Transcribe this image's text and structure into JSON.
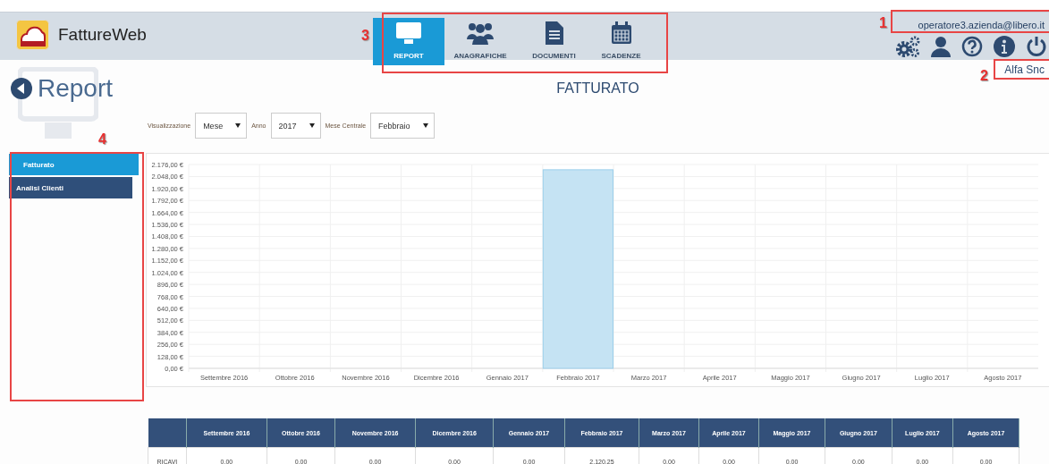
{
  "app": {
    "name": "FattureWeb"
  },
  "nav": [
    {
      "label": "REPORT",
      "selected": true
    },
    {
      "label": "ANAGRAFICHE",
      "selected": false
    },
    {
      "label": "DOCUMENTI",
      "selected": false
    },
    {
      "label": "SCADENZE",
      "selected": false
    }
  ],
  "user": {
    "email": "operatore3.azienda@libero.it",
    "company": "Alfa Snc"
  },
  "page": {
    "title": "Report",
    "heading": "FATTURATO"
  },
  "filters": [
    {
      "label": "Visualizzazione",
      "value": "Mese"
    },
    {
      "label": "Anno",
      "value": "2017"
    },
    {
      "label": "Mese Centrale",
      "value": "Febbraio"
    }
  ],
  "sidebar": {
    "items": [
      {
        "label": "Fatturato",
        "selected": true
      },
      {
        "label": "Analisi Clienti",
        "selected": false
      }
    ]
  },
  "chart_data": {
    "type": "bar",
    "categories": [
      "Settembre 2016",
      "Ottobre 2016",
      "Novembre 2016",
      "Dicembre 2016",
      "Gennaio 2017",
      "Febbraio 2017",
      "Marzo 2017",
      "Aprile 2017",
      "Maggio 2017",
      "Giugno 2017",
      "Luglio 2017",
      "Agosto 2017"
    ],
    "series": [
      {
        "color": "#c5e3f3",
        "values": [
          0,
          0,
          0,
          0,
          0,
          2120,
          0,
          0,
          0,
          0,
          0,
          0
        ]
      }
    ],
    "grid": true,
    "ylim": [
      0,
      2176
    ],
    "yticks": [
      {
        "value": 2176,
        "label": "2.176,00 €"
      },
      {
        "value": 2048,
        "label": "2.048,00 €"
      },
      {
        "value": 1920,
        "label": "1.920,00 €"
      },
      {
        "value": 1792,
        "label": "1.792,00 €"
      },
      {
        "value": 1664,
        "label": "1.664,00 €"
      },
      {
        "value": 1536,
        "label": "1.536,00 €"
      },
      {
        "value": 1408,
        "label": "1.408,00 €"
      },
      {
        "value": 1280,
        "label": "1.280,00 €"
      },
      {
        "value": 1152,
        "label": "1.152,00 €"
      },
      {
        "value": 1024,
        "label": "1.024,00 €"
      },
      {
        "value": 896,
        "label": "896,00 €"
      },
      {
        "value": 768,
        "label": "768,00 €"
      },
      {
        "value": 640,
        "label": "640,00 €"
      },
      {
        "value": 512,
        "label": "512,00 €"
      },
      {
        "value": 384,
        "label": "384,00 €"
      },
      {
        "value": 256,
        "label": "256,00 €"
      },
      {
        "value": 128,
        "label": "128,00 €"
      },
      {
        "value": 0,
        "label": "0,00 €"
      }
    ]
  },
  "table": {
    "columns": [
      "Settembre 2016",
      "Ottobre 2016",
      "Novembre 2016",
      "Dicembre 2016",
      "Gennaio 2017",
      "Febbraio 2017",
      "Marzo 2017",
      "Aprile 2017",
      "Maggio 2017",
      "Giugno 2017",
      "Luglio 2017",
      "Agosto 2017"
    ],
    "rows": [
      {
        "label": "RICAVI",
        "cells": [
          "0,00",
          "0,00",
          "0,00",
          "0,00",
          "0,00",
          "2.120,25",
          "0,00",
          "0,00",
          "0,00",
          "0,00",
          "0,00",
          "0,00"
        ]
      }
    ]
  },
  "annotations": [
    {
      "label": "1"
    },
    {
      "label": "2"
    },
    {
      "label": "3"
    },
    {
      "label": "4"
    }
  ]
}
